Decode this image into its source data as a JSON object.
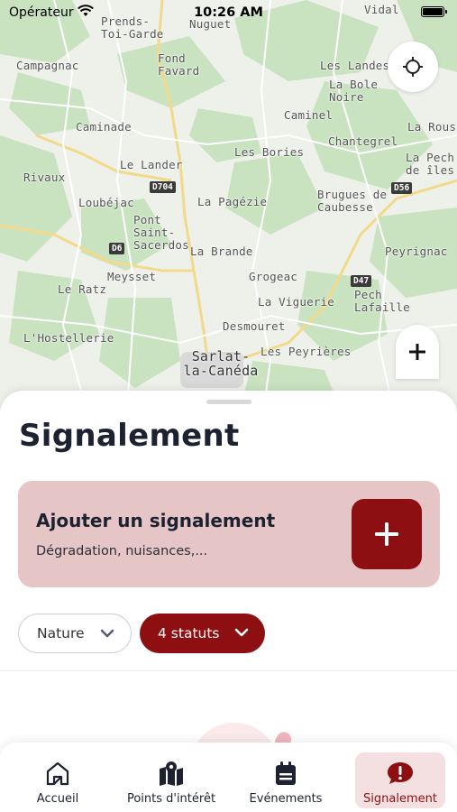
{
  "status_bar": {
    "carrier": "Opérateur",
    "time": "10:26 AM"
  },
  "map": {
    "places": [
      "Vidal",
      "Prends-Toi-Garde",
      "Nuguet",
      "Fond Favard",
      "Campagnac",
      "Les Landes",
      "La Bole Noire",
      "Caminel",
      "Chantegrel",
      "La Rouss",
      "Caminade",
      "Les Bories",
      "Le Lander",
      "La Pech de îles",
      "Rivaux",
      "Loubéjac",
      "La Pagézie",
      "Brugues de Caubesse",
      "Pont Saint-Sacerdos",
      "La Brande",
      "Peyrignac",
      "Meysset",
      "Grogeac",
      "Le Ratz",
      "La Viguerie",
      "Pech Lafaille",
      "Desmouret",
      "L'Hostellerie",
      "Les Peyrières",
      "Sarlat-la-Canéda"
    ],
    "roads": [
      "D704",
      "D56",
      "D6",
      "D47"
    ]
  },
  "sheet": {
    "title": "Signalement",
    "card": {
      "title": "Ajouter un signalement",
      "subtitle": "Dégradation, nuisances,..."
    },
    "filters": {
      "nature": "Nature",
      "status": "4 statuts"
    }
  },
  "tabs": [
    {
      "label": "Accueil",
      "icon": "home-icon"
    },
    {
      "label": "Points d'intérêt",
      "icon": "map-pin-icon"
    },
    {
      "label": "Evénements",
      "icon": "calendar-icon"
    },
    {
      "label": "Signalement",
      "icon": "alert-bubble-icon"
    }
  ],
  "colors": {
    "accent": "#8e0f12",
    "card_bg": "#e6c5c6",
    "active_tab_bg": "#f5e0e1"
  }
}
